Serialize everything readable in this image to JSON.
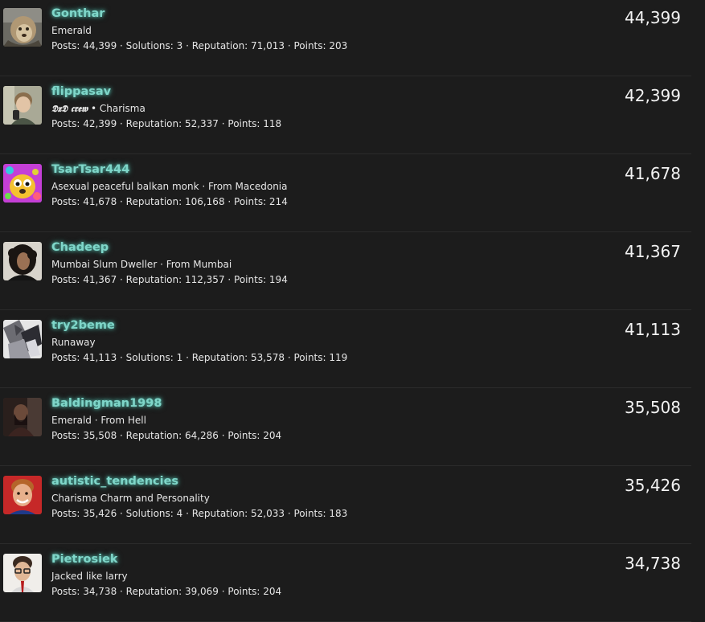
{
  "members": [
    {
      "name": "Gonthar",
      "title": "Emerald",
      "title_prefix": "",
      "stats": "Posts: 44,399 · Solutions: 3 · Reputation: 71,013 · Points: 203",
      "count": "44,399",
      "avatar_icon": "lion-avatar-icon"
    },
    {
      "name": "flippasav",
      "title_prefix": "𝕯𝖝𝕯 𝖈𝖗𝖊𝖜",
      "title": " • Charisma",
      "stats": "Posts: 42,399 · Reputation: 52,337 · Points: 118",
      "count": "42,399",
      "avatar_icon": "selfie-avatar-icon"
    },
    {
      "name": "TsarTsar444",
      "title_prefix": "",
      "title": "Asexual peaceful balkan monk · From Macedonia",
      "stats": "Posts: 41,678 · Reputation: 106,168 · Points: 214",
      "count": "41,678",
      "avatar_icon": "cartoon-dog-avatar-icon"
    },
    {
      "name": "Chadeep",
      "title_prefix": "",
      "title": "Mumbai Slum Dweller · From Mumbai",
      "stats": "Posts: 41,367 · Reputation: 112,357 · Points: 194",
      "count": "41,367",
      "avatar_icon": "curly-hair-avatar-icon"
    },
    {
      "name": "try2beme",
      "title_prefix": "",
      "title": "Runaway",
      "stats": "Posts: 41,113 · Solutions: 1 · Reputation: 53,578 · Points: 119",
      "count": "41,113",
      "avatar_icon": "anime-avatar-icon"
    },
    {
      "name": "Baldingman1998",
      "title_prefix": "",
      "title": "Emerald · From Hell",
      "stats": "Posts: 35,508 · Reputation: 64,286 · Points: 204",
      "count": "35,508",
      "avatar_icon": "dark-figure-avatar-icon"
    },
    {
      "name": "autistic_tendencies",
      "title_prefix": "",
      "title": "Charisma Charm and Personality",
      "stats": "Posts: 35,426 · Solutions: 4 · Reputation: 52,033 · Points: 183",
      "count": "35,426",
      "avatar_icon": "smiling-man-avatar-icon"
    },
    {
      "name": "Pietrosiek",
      "title_prefix": "",
      "title": "Jacked like larry",
      "stats": "Posts: 34,738 · Reputation: 39,069 · Points: 204",
      "count": "34,738",
      "avatar_icon": "glasses-man-avatar-icon"
    }
  ],
  "colors": {
    "background": "#1c1c1c",
    "username": "#7fd6c9",
    "text": "#e6e6e6",
    "divider": "#2b2b2b"
  }
}
